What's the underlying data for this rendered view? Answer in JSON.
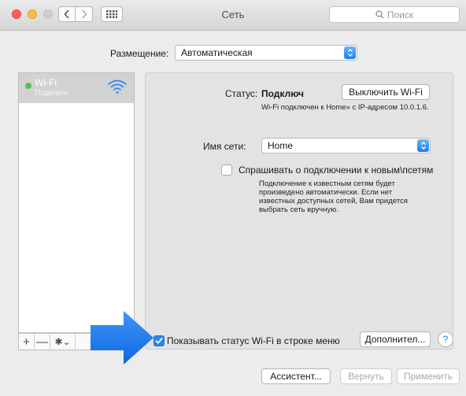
{
  "window": {
    "title": "Сеть"
  },
  "toolbar": {
    "search_placeholder": "Поиск"
  },
  "location": {
    "label": "Размещение:",
    "value": "Автоматическая"
  },
  "sidebar": {
    "items": [
      {
        "name": "Wi-Fi",
        "status": "Подключ",
        "status_color": "#52c44f"
      }
    ]
  },
  "sidebar_tools": {
    "add": "+",
    "remove": "—",
    "gear": "✱⌄"
  },
  "panel": {
    "status_label": "Статус:",
    "status_value": "Подключ",
    "turn_off_button": "Выключить Wi-Fi",
    "status_desc": "Wi-Fi подключен к Home» с IP-адресом 10.0.1.6.",
    "network_name_label": "Имя сети:",
    "network_name_value": "Home",
    "ask_to_join_label": "Спрашивать о подключении к новым\\псетям",
    "ask_to_join_desc": "Подключение к известным сетям будет произведено автоматически. Если нет известных доступных сетей, Вам придется выбрать сеть вручную."
  },
  "bottom": {
    "show_status_label": "Показывать статус Wi-Fi в строке меню",
    "show_status_checked": true,
    "advanced_button": "Дополнител...",
    "help_button": "?"
  },
  "footer": {
    "assist_button": "Ассистент...",
    "revert_button": "Вернуть",
    "apply_button": "Применить"
  },
  "colors": {
    "accent": "#2d86f0",
    "arrow": "#1f7ef0"
  }
}
